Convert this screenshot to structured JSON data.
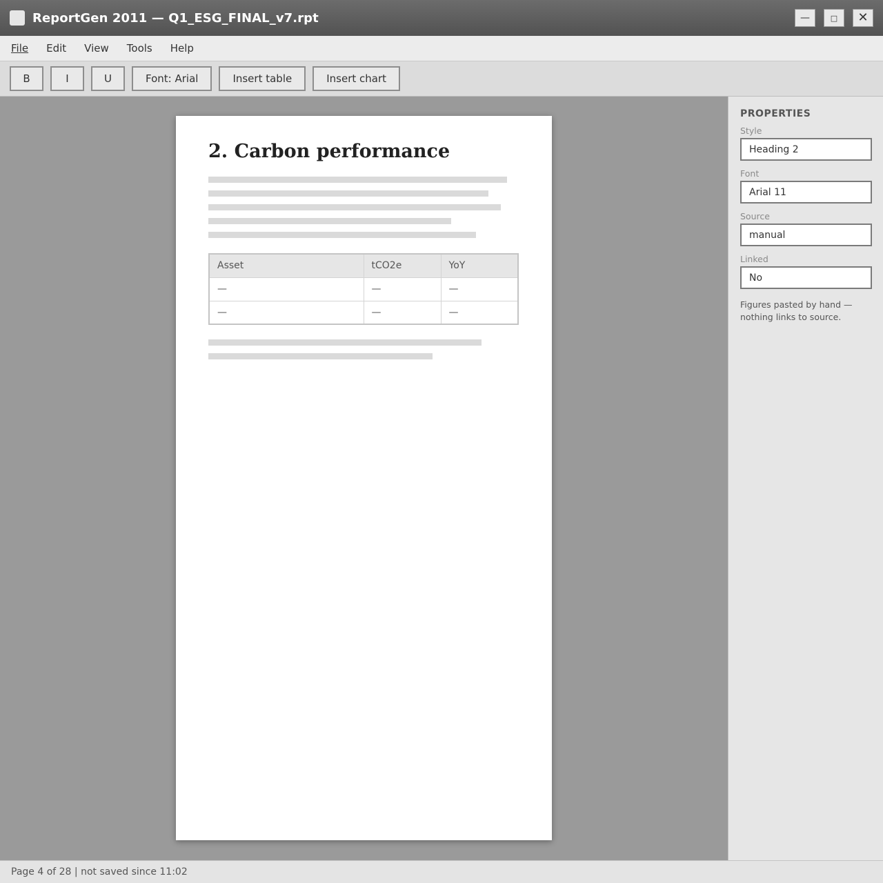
{
  "window": {
    "title": "ReportGen 2011 — Q1_ESG_FINAL_v7.rpt",
    "icon": "app-icon",
    "controls": {
      "minimize": "—",
      "maximize": "□",
      "close": "✕"
    }
  },
  "menu": {
    "items": [
      "File",
      "Edit",
      "View",
      "Tools",
      "Help"
    ]
  },
  "toolbar": {
    "bold": "B",
    "italic": "I",
    "underline": "U",
    "font": "Font: Arial",
    "insert_table": "Insert table",
    "insert_chart": "Insert chart"
  },
  "document": {
    "heading": "2. Carbon performance",
    "table": {
      "headers": [
        "Asset",
        "tCO2e",
        "YoY"
      ],
      "rows": [
        [
          "—",
          "—",
          "—"
        ],
        [
          "—",
          "—",
          "—"
        ]
      ]
    }
  },
  "properties": {
    "title": "PROPERTIES",
    "fields": [
      {
        "label": "Style",
        "value": "Heading 2"
      },
      {
        "label": "Font",
        "value": "Arial 11"
      },
      {
        "label": "Source",
        "value": "manual"
      },
      {
        "label": "Linked",
        "value": "No"
      }
    ],
    "note": "Figures pasted by hand — nothing links to source."
  },
  "status": {
    "text": "Page 4 of 28 | not saved since 11:02"
  }
}
